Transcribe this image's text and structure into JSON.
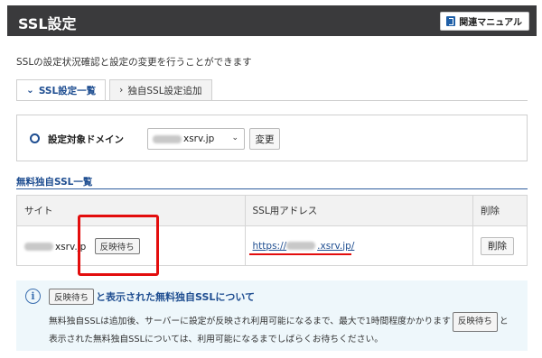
{
  "header": {
    "title": "SSL設定",
    "manual_label": "関連マニュアル"
  },
  "intro_text": "SSLの設定状況確認と設定の変更を行うことができます",
  "tabs": [
    {
      "label": "SSL設定一覧",
      "active": true,
      "icon": "chevron-down-icon"
    },
    {
      "label": "独自SSL設定追加",
      "active": false,
      "icon": "chevron-right-icon"
    }
  ],
  "domain_selector": {
    "label": "設定対象ドメイン",
    "selected_value": "xsrv.jp",
    "change_label": "変更"
  },
  "section": {
    "title": "無料独自SSL一覧"
  },
  "table": {
    "headers": [
      "サイト",
      "SSL用アドレス",
      "削除"
    ],
    "rows": [
      {
        "site": "xsrv.jp",
        "status": "反映待ち",
        "address_prefix": "https://",
        "address_suffix": ".xsrv.jp/",
        "delete_label": "削除"
      }
    ]
  },
  "info": {
    "badge": "反映待ち",
    "title": "と表示された無料独自SSLについて",
    "body_1": "無料独自SSLは追加後、サーバーに設定が反映され利用可能になるまで、最大で1時間程度かかります",
    "body_badge": "反映待ち",
    "body_2": "と",
    "body_3": "表示された無料独自SSLについては、利用可能になるまでしばらくお待ちください。"
  },
  "colors": {
    "header_bg": "#3a3a3c",
    "accent_blue": "#1f4e91",
    "highlight_red": "#e30d0d",
    "info_bg": "#eef7fb"
  }
}
